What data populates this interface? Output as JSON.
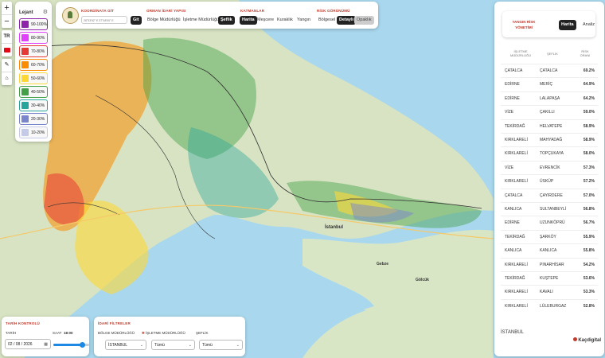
{
  "map_controls": {
    "zoom_in": "+",
    "zoom_out": "−",
    "language": "TR"
  },
  "legend": {
    "title": "Lejant",
    "items": [
      {
        "label": "90-100%",
        "color": "#8e24aa"
      },
      {
        "label": "80-90%",
        "color": "#e040fb"
      },
      {
        "label": "70-80%",
        "color": "#e53935"
      },
      {
        "label": "60-70%",
        "color": "#fb8c00"
      },
      {
        "label": "50-60%",
        "color": "#fdd835"
      },
      {
        "label": "40-50%",
        "color": "#43a047"
      },
      {
        "label": "30-40%",
        "color": "#26a69a"
      },
      {
        "label": "20-30%",
        "color": "#7986cb"
      },
      {
        "label": "10-20%",
        "color": "#c5cae9"
      }
    ]
  },
  "topbar": {
    "coordinate_label": "KOORDİNATA GİT",
    "coordinate_placeholder": "28°33'52\" E 37°48'00\" E",
    "go_button": "Git",
    "forest_label": "ORMAN İDARİ YAPISI",
    "forest_options": [
      "Bölge Müdürlüğü",
      "İşletme Müdürlüğü",
      "Şeflik"
    ],
    "layers_label": "KATMANLAR",
    "layer_options": [
      "Harita",
      "Meşcere",
      "Kuraklık",
      "Yangın"
    ],
    "risk_view_label": "RİSK GÖRÜNÜMÜ",
    "risk_view_options": [
      "Bölgesel",
      "Detaylı",
      "Opaklık"
    ]
  },
  "right_panel": {
    "title_line1": "YANGIN RİSK",
    "title_line2": "YÖNETİMİ",
    "tab_map": "Harita",
    "tab_analysis": "Analiz",
    "columns": [
      "İŞLETME MÜDÜRLÜĞÜ",
      "ŞEFLİK",
      "RİSK ORANI"
    ],
    "rows": [
      [
        "ÇATALCA",
        "ÇATALCA",
        "69.2%"
      ],
      [
        "EDİRNE",
        "MERİÇ",
        "64.9%"
      ],
      [
        "EDİRNE",
        "LALAPAŞA",
        "64.2%"
      ],
      [
        "VİZE",
        "ÇAKILLI",
        "59.0%"
      ],
      [
        "TEKİRDAĞ",
        "HELVATEPE",
        "58.9%"
      ],
      [
        "KIRKLARELİ",
        "MAHYADAĞ",
        "58.9%"
      ],
      [
        "KIRKLARELİ",
        "TOPÇUKAYA",
        "58.0%"
      ],
      [
        "VİZE",
        "EVRENCİK",
        "57.3%"
      ],
      [
        "KIRKLARELİ",
        "ÜSKÜP",
        "57.2%"
      ],
      [
        "ÇATALCA",
        "ÇAYIRDERE",
        "57.0%"
      ],
      [
        "KANLICA",
        "SULTANBEYLİ",
        "56.8%"
      ],
      [
        "EDİRNE",
        "UZUNKÖPRÜ",
        "56.7%"
      ],
      [
        "TEKİRDAĞ",
        "ŞARKÖY",
        "55.9%"
      ],
      [
        "KANLICA",
        "KANLICA",
        "55.8%"
      ],
      [
        "KIRKLARELİ",
        "PINARHİSAR",
        "54.2%"
      ],
      [
        "TEKİRDAĞ",
        "KUŞTEPE",
        "53.6%"
      ],
      [
        "KIRKLARELİ",
        "KAVALI",
        "53.3%"
      ],
      [
        "KIRKLARELİ",
        "LÜLEBURGAZ",
        "52.8%"
      ]
    ],
    "footer_region": "İSTANBUL",
    "brand": "Kaçdigital"
  },
  "time_panel": {
    "title": "TARİH KONTROLÜ",
    "date_label": "TARİH",
    "time_label": "SAAT",
    "time_value": "18:00",
    "date_value": "02 / 08 / 2026",
    "slider_value": 0.8
  },
  "filter_panel": {
    "title": "İDARİ FİLTRELER",
    "region_label": "BÖLGE MÜDÜRLÜĞÜ",
    "region_value": "İSTANBUL",
    "management_label": "İŞLETME MÜDÜRLÜĞÜ",
    "management_value": "Tümü",
    "chief_label": "ŞEFLİK",
    "chief_value": "Tümü"
  },
  "map_labels": {
    "istanbul": "İstanbul",
    "gebze": "Gebze",
    "golcuk": "Gölcük",
    "attribution": "© Google Maps"
  }
}
